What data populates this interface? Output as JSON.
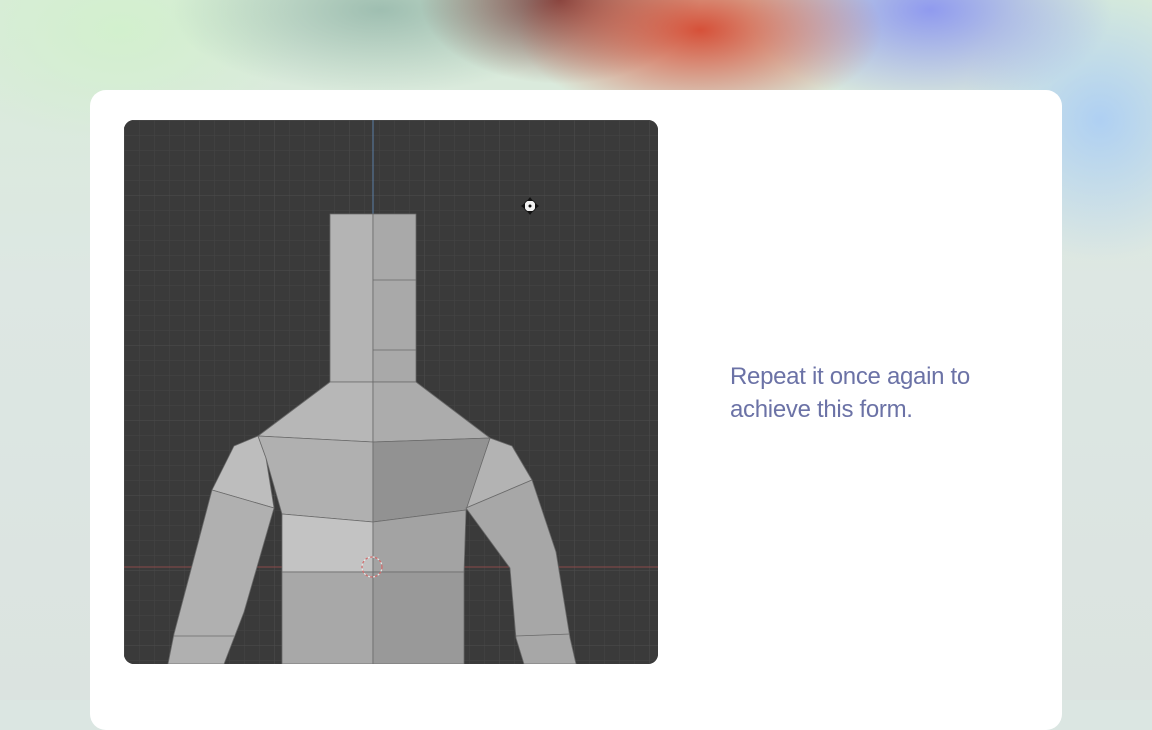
{
  "step": {
    "caption": "Repeat it once again to achieve this form."
  },
  "viewport": {
    "subject": "low-poly torso mesh, front orthographic view",
    "background_color": "#3a3a3a",
    "mesh_color": "#b3b3b3",
    "icons": [
      "move-gizmo-icon",
      "3d-cursor-icon"
    ]
  },
  "theme": {
    "card_color": "#ffffff",
    "caption_color": "#6b72a6"
  }
}
